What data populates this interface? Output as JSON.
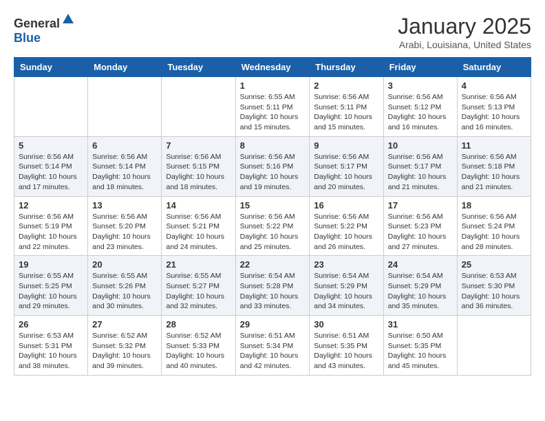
{
  "header": {
    "logo_general": "General",
    "logo_blue": "Blue",
    "month": "January 2025",
    "location": "Arabi, Louisiana, United States"
  },
  "days_of_week": [
    "Sunday",
    "Monday",
    "Tuesday",
    "Wednesday",
    "Thursday",
    "Friday",
    "Saturday"
  ],
  "weeks": [
    {
      "stripe": false,
      "days": [
        {
          "number": "",
          "info": ""
        },
        {
          "number": "",
          "info": ""
        },
        {
          "number": "",
          "info": ""
        },
        {
          "number": "1",
          "info": "Sunrise: 6:55 AM\nSunset: 5:11 PM\nDaylight: 10 hours\nand 15 minutes."
        },
        {
          "number": "2",
          "info": "Sunrise: 6:56 AM\nSunset: 5:11 PM\nDaylight: 10 hours\nand 15 minutes."
        },
        {
          "number": "3",
          "info": "Sunrise: 6:56 AM\nSunset: 5:12 PM\nDaylight: 10 hours\nand 16 minutes."
        },
        {
          "number": "4",
          "info": "Sunrise: 6:56 AM\nSunset: 5:13 PM\nDaylight: 10 hours\nand 16 minutes."
        }
      ]
    },
    {
      "stripe": true,
      "days": [
        {
          "number": "5",
          "info": "Sunrise: 6:56 AM\nSunset: 5:14 PM\nDaylight: 10 hours\nand 17 minutes."
        },
        {
          "number": "6",
          "info": "Sunrise: 6:56 AM\nSunset: 5:14 PM\nDaylight: 10 hours\nand 18 minutes."
        },
        {
          "number": "7",
          "info": "Sunrise: 6:56 AM\nSunset: 5:15 PM\nDaylight: 10 hours\nand 18 minutes."
        },
        {
          "number": "8",
          "info": "Sunrise: 6:56 AM\nSunset: 5:16 PM\nDaylight: 10 hours\nand 19 minutes."
        },
        {
          "number": "9",
          "info": "Sunrise: 6:56 AM\nSunset: 5:17 PM\nDaylight: 10 hours\nand 20 minutes."
        },
        {
          "number": "10",
          "info": "Sunrise: 6:56 AM\nSunset: 5:17 PM\nDaylight: 10 hours\nand 21 minutes."
        },
        {
          "number": "11",
          "info": "Sunrise: 6:56 AM\nSunset: 5:18 PM\nDaylight: 10 hours\nand 21 minutes."
        }
      ]
    },
    {
      "stripe": false,
      "days": [
        {
          "number": "12",
          "info": "Sunrise: 6:56 AM\nSunset: 5:19 PM\nDaylight: 10 hours\nand 22 minutes."
        },
        {
          "number": "13",
          "info": "Sunrise: 6:56 AM\nSunset: 5:20 PM\nDaylight: 10 hours\nand 23 minutes."
        },
        {
          "number": "14",
          "info": "Sunrise: 6:56 AM\nSunset: 5:21 PM\nDaylight: 10 hours\nand 24 minutes."
        },
        {
          "number": "15",
          "info": "Sunrise: 6:56 AM\nSunset: 5:22 PM\nDaylight: 10 hours\nand 25 minutes."
        },
        {
          "number": "16",
          "info": "Sunrise: 6:56 AM\nSunset: 5:22 PM\nDaylight: 10 hours\nand 26 minutes."
        },
        {
          "number": "17",
          "info": "Sunrise: 6:56 AM\nSunset: 5:23 PM\nDaylight: 10 hours\nand 27 minutes."
        },
        {
          "number": "18",
          "info": "Sunrise: 6:56 AM\nSunset: 5:24 PM\nDaylight: 10 hours\nand 28 minutes."
        }
      ]
    },
    {
      "stripe": true,
      "days": [
        {
          "number": "19",
          "info": "Sunrise: 6:55 AM\nSunset: 5:25 PM\nDaylight: 10 hours\nand 29 minutes."
        },
        {
          "number": "20",
          "info": "Sunrise: 6:55 AM\nSunset: 5:26 PM\nDaylight: 10 hours\nand 30 minutes."
        },
        {
          "number": "21",
          "info": "Sunrise: 6:55 AM\nSunset: 5:27 PM\nDaylight: 10 hours\nand 32 minutes."
        },
        {
          "number": "22",
          "info": "Sunrise: 6:54 AM\nSunset: 5:28 PM\nDaylight: 10 hours\nand 33 minutes."
        },
        {
          "number": "23",
          "info": "Sunrise: 6:54 AM\nSunset: 5:29 PM\nDaylight: 10 hours\nand 34 minutes."
        },
        {
          "number": "24",
          "info": "Sunrise: 6:54 AM\nSunset: 5:29 PM\nDaylight: 10 hours\nand 35 minutes."
        },
        {
          "number": "25",
          "info": "Sunrise: 6:53 AM\nSunset: 5:30 PM\nDaylight: 10 hours\nand 36 minutes."
        }
      ]
    },
    {
      "stripe": false,
      "days": [
        {
          "number": "26",
          "info": "Sunrise: 6:53 AM\nSunset: 5:31 PM\nDaylight: 10 hours\nand 38 minutes."
        },
        {
          "number": "27",
          "info": "Sunrise: 6:52 AM\nSunset: 5:32 PM\nDaylight: 10 hours\nand 39 minutes."
        },
        {
          "number": "28",
          "info": "Sunrise: 6:52 AM\nSunset: 5:33 PM\nDaylight: 10 hours\nand 40 minutes."
        },
        {
          "number": "29",
          "info": "Sunrise: 6:51 AM\nSunset: 5:34 PM\nDaylight: 10 hours\nand 42 minutes."
        },
        {
          "number": "30",
          "info": "Sunrise: 6:51 AM\nSunset: 5:35 PM\nDaylight: 10 hours\nand 43 minutes."
        },
        {
          "number": "31",
          "info": "Sunrise: 6:50 AM\nSunset: 5:35 PM\nDaylight: 10 hours\nand 45 minutes."
        },
        {
          "number": "",
          "info": ""
        }
      ]
    }
  ]
}
